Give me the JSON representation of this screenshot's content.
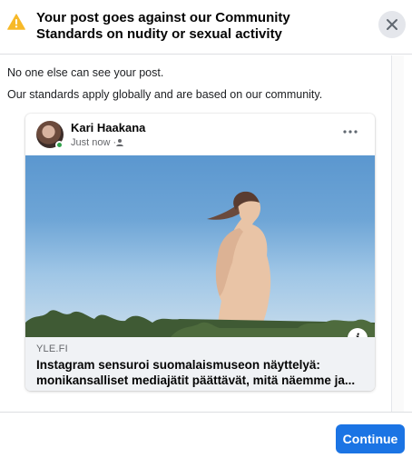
{
  "dialog": {
    "title": "Your post goes against our Community Standards on nudity or sexual activity",
    "close_icon": "close-icon",
    "warning_icon": "warning-triangle-icon"
  },
  "message": {
    "line1": "No one else can see your post.",
    "line2": "Our standards apply globally and are based on our community."
  },
  "post": {
    "author": "Kari Haakana",
    "time": "Just now ·",
    "audience_icon": "friends-icon",
    "more_icon": "more-options-icon",
    "link": {
      "domain": "YLE.FI",
      "title": "Instagram sensuroi suomalaismuseon näyttelyä: monikansalliset mediajätit päättävät, mitä näemme ja..."
    }
  },
  "footer": {
    "continue_label": "Continue"
  },
  "colors": {
    "primary": "#1b74e4",
    "warning": "#f7b928",
    "online": "#31a24c"
  }
}
